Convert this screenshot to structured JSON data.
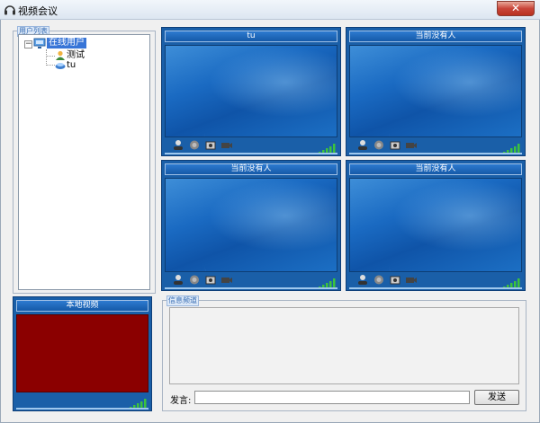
{
  "window": {
    "title": "视频会议",
    "close_label": "✕"
  },
  "user_list": {
    "group_label": "用户列表",
    "root_label": "在线用户",
    "toggle": "−",
    "users": [
      {
        "name": "测试"
      },
      {
        "name": "tu"
      }
    ]
  },
  "video_panels": [
    {
      "title": "tu"
    },
    {
      "title": "当前没有人"
    },
    {
      "title": "当前没有人"
    },
    {
      "title": "当前没有人"
    }
  ],
  "local_video": {
    "title": "本地视频"
  },
  "chat": {
    "group_label": "信息频道",
    "input_label": "发言:",
    "input_value": "",
    "send_label": "发送"
  },
  "colors": {
    "panel_blue": "#1a5fa8",
    "local_video_bg": "#8b0000",
    "signal_green": "#3cc33c",
    "selection": "#3875d7"
  }
}
